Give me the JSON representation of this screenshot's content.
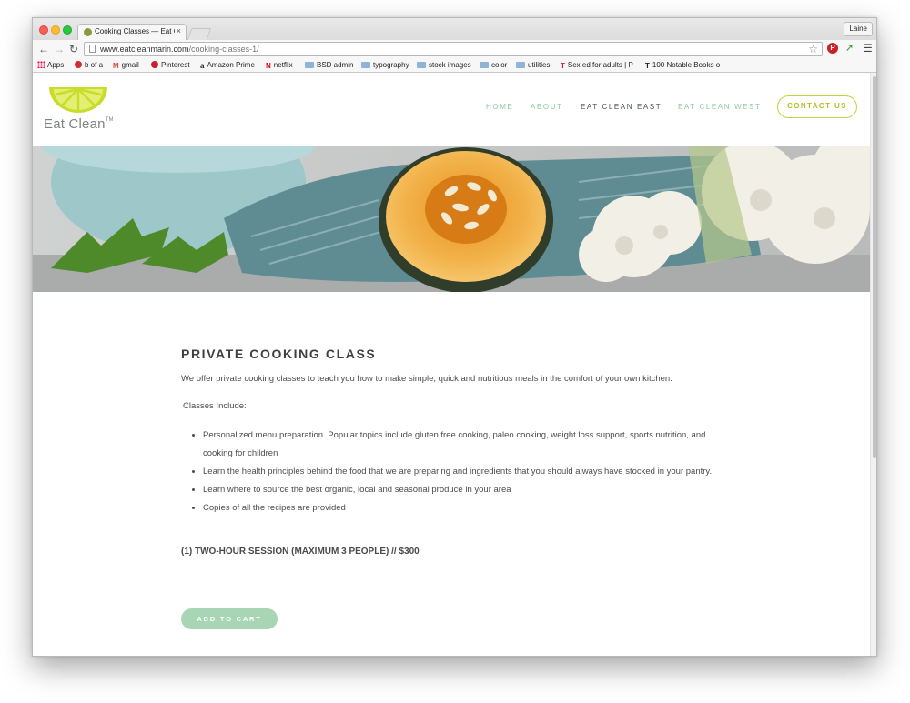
{
  "browser": {
    "tab_title": "Cooking Classes — Eat Cl",
    "tab_close": "×",
    "profile_name": "Laine",
    "url_host": "www.eatcleanmarin.com",
    "url_path": "/cooking-classes-1/",
    "bookmarks": [
      {
        "label": "Apps",
        "icon": "apps-grid-icon"
      },
      {
        "label": "b of a",
        "icon": "bofa-icon"
      },
      {
        "label": "gmail",
        "icon": "gmail-icon"
      },
      {
        "label": "Pinterest",
        "icon": "pinterest-icon"
      },
      {
        "label": "Amazon Prime",
        "icon": "amazon-icon"
      },
      {
        "label": "netflix",
        "icon": "netflix-icon"
      },
      {
        "label": "BSD admin",
        "icon": "folder-icon"
      },
      {
        "label": "typography",
        "icon": "folder-icon"
      },
      {
        "label": "stock images",
        "icon": "folder-icon"
      },
      {
        "label": "color",
        "icon": "folder-icon"
      },
      {
        "label": "utilities",
        "icon": "folder-icon"
      },
      {
        "label": "Sex ed for adults | P",
        "icon": "t-icon"
      },
      {
        "label": "100 Notable Books o",
        "icon": "nyt-icon"
      }
    ]
  },
  "site": {
    "logo_text": "Eat Clean",
    "logo_tm": "TM",
    "nav": [
      {
        "label": "HOME"
      },
      {
        "label": "ABOUT"
      },
      {
        "label": "EAT CLEAN EAST"
      },
      {
        "label": "EAT CLEAN WEST"
      }
    ],
    "contact_label": "CONTACT US",
    "accent_green": "#8fc79f",
    "accent_lime": "#c7d13a"
  },
  "content": {
    "title": "PRIVATE COOKING CLASS",
    "intro": "We offer private cooking classes to teach you how to make simple, quick and nutritious meals in the comfort of your own kitchen.",
    "classes_include": "Classes Include:",
    "bullets": [
      "Personalized menu preparation. Popular topics include gluten free cooking, paleo cooking, weight loss support, sports nutrition, and cooking for children",
      "Learn the health principles behind the food that we are preparing and ingredients that you should always have stocked in your pantry.",
      "Learn where to source the best organic, local and seasonal produce in your area",
      "Copies of all the recipes are provided"
    ],
    "price_line": "(1) TWO-HOUR SESSION (MAXIMUM 3 PEOPLE) // $300",
    "cart_label": "ADD TO CART"
  }
}
